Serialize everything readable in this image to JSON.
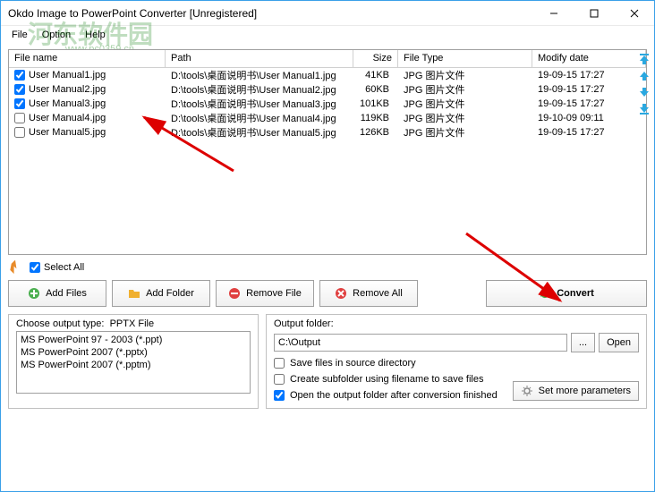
{
  "window": {
    "title": "Okdo Image to PowerPoint Converter [Unregistered]"
  },
  "menu": {
    "file": "File",
    "option": "Option",
    "help": "Help"
  },
  "watermark": {
    "text": "河东软件园",
    "url": "www.pc0359.cn"
  },
  "columns": {
    "name": "File name",
    "path": "Path",
    "size": "Size",
    "type": "File Type",
    "date": "Modify date"
  },
  "files": [
    {
      "checked": true,
      "name": "User Manual1.jpg",
      "path": "D:\\tools\\桌面说明书\\User Manual1.jpg",
      "size": "41KB",
      "type": "JPG 图片文件",
      "date": "19-09-15 17:27"
    },
    {
      "checked": true,
      "name": "User Manual2.jpg",
      "path": "D:\\tools\\桌面说明书\\User Manual2.jpg",
      "size": "60KB",
      "type": "JPG 图片文件",
      "date": "19-09-15 17:27"
    },
    {
      "checked": true,
      "name": "User Manual3.jpg",
      "path": "D:\\tools\\桌面说明书\\User Manual3.jpg",
      "size": "101KB",
      "type": "JPG 图片文件",
      "date": "19-09-15 17:27"
    },
    {
      "checked": false,
      "name": "User Manual4.jpg",
      "path": "D:\\tools\\桌面说明书\\User Manual4.jpg",
      "size": "119KB",
      "type": "JPG 图片文件",
      "date": "19-10-09 09:11"
    },
    {
      "checked": false,
      "name": "User Manual5.jpg",
      "path": "D:\\tools\\桌面说明书\\User Manual5.jpg",
      "size": "126KB",
      "type": "JPG 图片文件",
      "date": "19-09-15 17:27"
    }
  ],
  "selectAll": {
    "label": "Select All",
    "checked": true
  },
  "buttons": {
    "addFiles": "Add Files",
    "addFolder": "Add Folder",
    "removeFile": "Remove File",
    "removeAll": "Remove All",
    "convert": "Convert",
    "browse": "...",
    "open": "Open",
    "setMore": "Set more parameters"
  },
  "outputType": {
    "label": "Choose output type:",
    "value": "PPTX File",
    "options": [
      "MS PowerPoint 97 - 2003 (*.ppt)",
      "MS PowerPoint 2007 (*.pptx)",
      "MS PowerPoint 2007 (*.pptm)"
    ]
  },
  "outputFolder": {
    "label": "Output folder:",
    "value": "C:\\Output",
    "saveInSource": {
      "label": "Save files in source directory",
      "checked": false
    },
    "createSub": {
      "label": "Create subfolder using filename to save files",
      "checked": false
    },
    "openAfter": {
      "label": "Open the output folder after conversion finished",
      "checked": true
    }
  }
}
